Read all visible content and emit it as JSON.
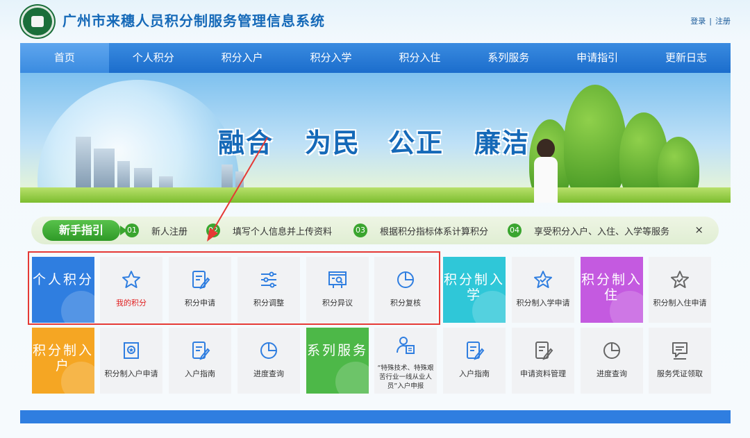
{
  "header": {
    "title": "广州市来穗人员积分制服务管理信息系统",
    "login": "登录",
    "separator": "|",
    "register": "注册"
  },
  "nav": {
    "items": [
      "首页",
      "个人积分",
      "积分入户",
      "积分入学",
      "积分入住",
      "系列服务",
      "申请指引",
      "更新日志"
    ]
  },
  "banner": {
    "slogans": [
      "融合",
      "为民",
      "公正",
      "廉洁"
    ]
  },
  "guide": {
    "label": "新手指引",
    "steps": [
      {
        "num": "01",
        "text": "新人注册"
      },
      {
        "num": "02",
        "text": "填写个人信息并上传资料"
      },
      {
        "num": "03",
        "text": "根据积分指标体系计算积分"
      },
      {
        "num": "04",
        "text": "享受积分入户、入住、入学等服务"
      }
    ],
    "close": "×"
  },
  "tiles": {
    "row1": {
      "personal": {
        "title": "个人积分"
      },
      "my_points": "我的积分",
      "points_apply": "积分申请",
      "points_adjust": "积分调整",
      "points_objection": "积分异议",
      "points_review": "积分复核",
      "school": {
        "title": "积分制入学"
      },
      "school_apply": "积分制入学申请",
      "housing": {
        "title": "积分制入住"
      },
      "housing_apply": "积分制入住申请"
    },
    "row2": {
      "hukou": {
        "title": "积分制入户"
      },
      "hukou_apply": "积分制入户申请",
      "hukou_guide": "入户指南",
      "progress_query": "进度查询",
      "series": {
        "title": "系列服务"
      },
      "special_declare": "“特殊技术、特殊艰苦行业一线从业人员”入户申报",
      "guide2": "入户指南",
      "material_manage": "申请资料管理",
      "progress_query2": "进度查询",
      "voucher": "服务凭证领取"
    }
  },
  "colors": {
    "primary": "#2f7ee0",
    "cyan": "#2fc7d8",
    "purple": "#c45ae0",
    "orange": "#f5a623",
    "green": "#4db848",
    "highlight": "#e53935"
  }
}
